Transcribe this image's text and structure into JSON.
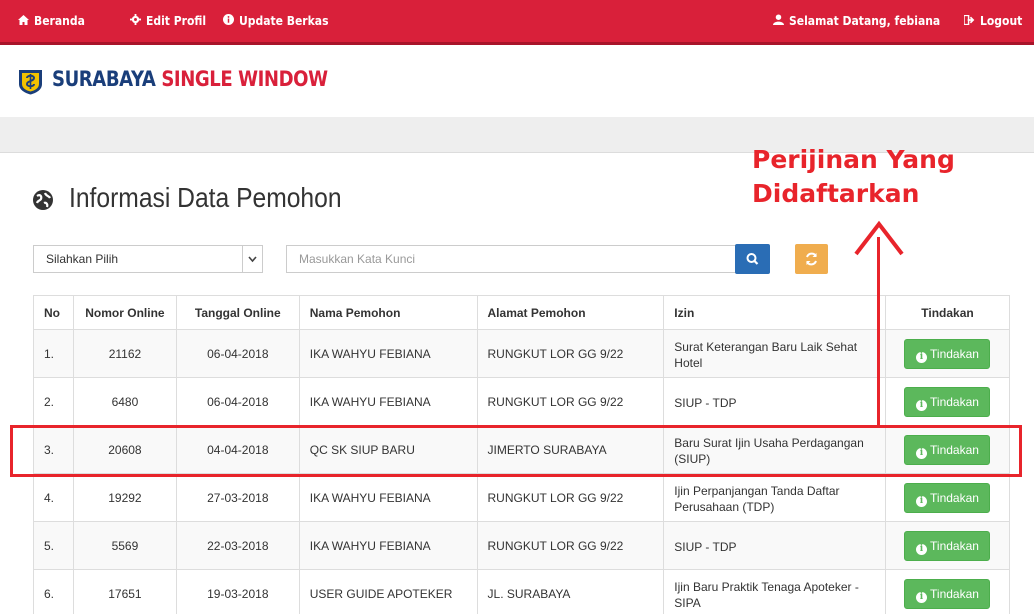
{
  "nav": {
    "beranda": "Beranda",
    "edit_profil": "Edit Profil",
    "update_berkas": "Update Berkas",
    "welcome": "Selamat Datang, febiana",
    "logout": "Logout"
  },
  "brand": {
    "part1": "SURABAYA",
    "part2": "SINGLE WINDOW"
  },
  "page_title": "Informasi Data Pemohon",
  "annotation": "Perijinan Yang Didaftarkan",
  "filter": {
    "select_value": "Silahkan Pilih",
    "search_placeholder": "Masukkan Kata Kunci"
  },
  "table": {
    "headers": [
      "No",
      "Nomor Online",
      "Tanggal Online",
      "Nama Pemohon",
      "Alamat Pemohon",
      "Izin",
      "Tindakan"
    ],
    "rows": [
      {
        "no": "1.",
        "nomor": "21162",
        "tanggal": "06-04-2018",
        "nama": "IKA WAHYU FEBIANA",
        "alamat": "RUNGKUT LOR GG 9/22",
        "izin": "Surat Keterangan Baru Laik Sehat Hotel",
        "action": "Tindakan"
      },
      {
        "no": "2.",
        "nomor": "6480",
        "tanggal": "06-04-2018",
        "nama": "IKA WAHYU FEBIANA",
        "alamat": "RUNGKUT LOR GG 9/22",
        "izin": "SIUP - TDP",
        "action": "Tindakan"
      },
      {
        "no": "3.",
        "nomor": "20608",
        "tanggal": "04-04-2018",
        "nama": "QC SK SIUP BARU",
        "alamat": "JIMERTO SURABAYA",
        "izin": "Baru Surat Ijin Usaha Perdagangan (SIUP)",
        "action": "Tindakan"
      },
      {
        "no": "4.",
        "nomor": "19292",
        "tanggal": "27-03-2018",
        "nama": "IKA WAHYU FEBIANA",
        "alamat": "RUNGKUT LOR GG 9/22",
        "izin": "Ijin Perpanjangan Tanda Daftar Perusahaan (TDP)",
        "action": "Tindakan"
      },
      {
        "no": "5.",
        "nomor": "5569",
        "tanggal": "22-03-2018",
        "nama": "IKA WAHYU FEBIANA",
        "alamat": "RUNGKUT LOR GG 9/22",
        "izin": "SIUP - TDP",
        "action": "Tindakan"
      },
      {
        "no": "6.",
        "nomor": "17651",
        "tanggal": "19-03-2018",
        "nama": "USER GUIDE APOTEKER",
        "alamat": "JL. SURABAYA",
        "izin": "Ijin Baru Praktik Tenaga Apoteker - SIPA",
        "action": "Tindakan"
      }
    ]
  },
  "colors": {
    "nav_red": "#d9203a",
    "brand_blue": "#1a3e7a",
    "action_green": "#5cb85c",
    "search_blue": "#2a6db5",
    "refresh_orange": "#f0ad4e",
    "annotation_red": "#e8242b"
  },
  "icons": {
    "home": "home-icon",
    "edit": "gear-icon",
    "update": "info-icon",
    "user": "user-icon",
    "logout": "logout-icon",
    "globe": "globe-icon",
    "search": "search-icon",
    "refresh": "refresh-icon",
    "action": "info-circle-icon"
  }
}
